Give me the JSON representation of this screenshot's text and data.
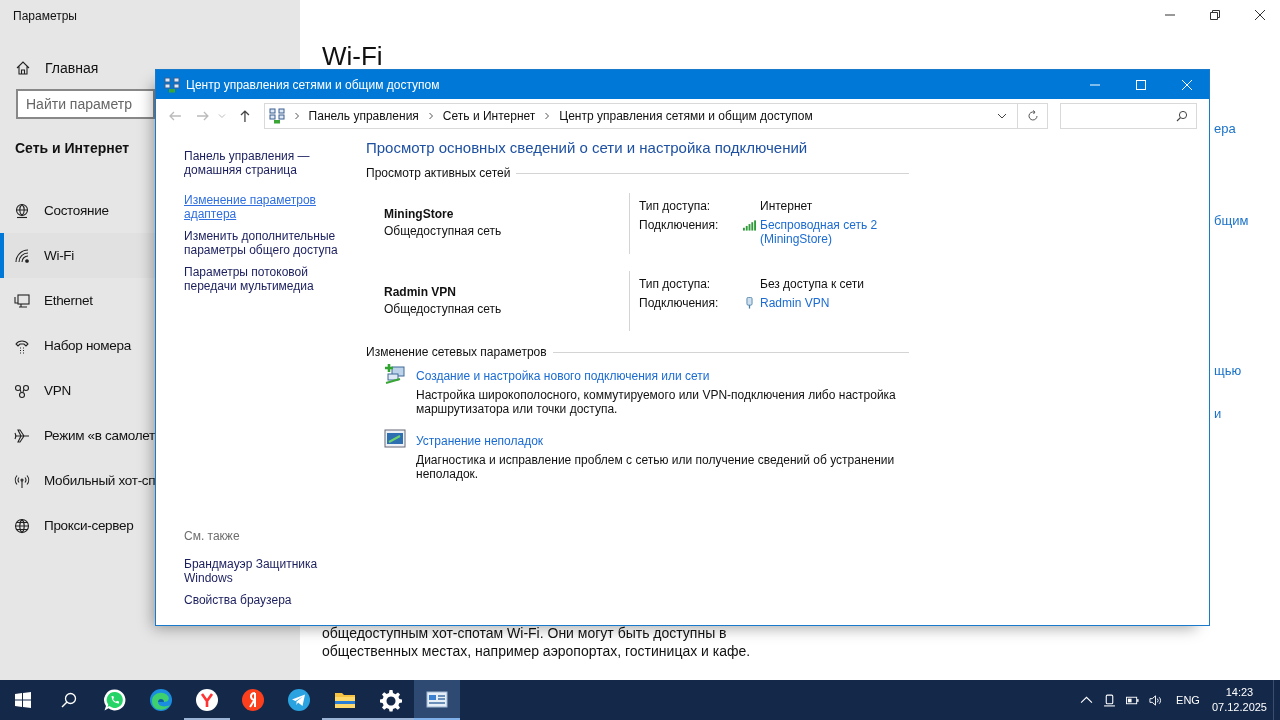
{
  "settings": {
    "title": "Параметры",
    "home": "Главная",
    "search": {
      "placeholder": "Найти параметр"
    },
    "section": "Сеть и Интернет",
    "nav": [
      {
        "label": "Состояние",
        "kind": "status",
        "selected": false
      },
      {
        "label": "Wi-Fi",
        "kind": "wifi",
        "selected": true
      },
      {
        "label": "Ethernet",
        "kind": "ethernet",
        "selected": false
      },
      {
        "label": "Набор номера",
        "kind": "dialup",
        "selected": false
      },
      {
        "label": "VPN",
        "kind": "vpn",
        "selected": false
      },
      {
        "label": "Режим «в самолет",
        "kind": "airplane",
        "selected": false
      },
      {
        "label": "Мобильный хот-сп",
        "kind": "hotspot",
        "selected": false
      },
      {
        "label": "Прокси-сервер",
        "kind": "proxy",
        "selected": false
      }
    ],
    "page_title": "Wi-Fi",
    "related_fragments": [
      "ера",
      "бщим",
      "щью",
      "и"
    ],
    "paragraph_lines": [
      "общедоступным хот-спотам Wi-Fi. Они могут быть доступны в",
      "общественных местах, например аэропортах, гостиницах и кафе."
    ]
  },
  "control_panel": {
    "title": "Центр управления сетями и общим доступом",
    "breadcrumbs": [
      "Панель управления",
      "Сеть и Интернет",
      "Центр управления сетями и общим доступом"
    ],
    "tasks": [
      {
        "label": "Панель управления — домашняя страница",
        "hovered": false
      },
      {
        "label": "Изменение параметров адаптера",
        "hovered": true
      },
      {
        "label": "Изменить дополнительные параметры общего доступа",
        "hovered": false
      },
      {
        "label": "Параметры потоковой передачи мультимедиа",
        "hovered": false
      }
    ],
    "see_also": {
      "title": "См. также",
      "links": [
        "Брандмауэр Защитника Windows",
        "Свойства браузера"
      ]
    },
    "heading": "Просмотр основных сведений о сети и настройка подключений",
    "active_networks": {
      "title": "Просмотр активных сетей",
      "networks": [
        {
          "name": "MiningStore",
          "category": "Общедоступная сеть",
          "access_label": "Тип доступа:",
          "access": "Интернет",
          "connections_label": "Подключения:",
          "connection": {
            "kind": "wifi",
            "label": "Беспроводная сеть 2 (MiningStore)"
          }
        },
        {
          "name": "Radmin VPN",
          "category": "Общедоступная сеть",
          "access_label": "Тип доступа:",
          "access": "Без доступа к сети",
          "connections_label": "Подключения:",
          "connection": {
            "kind": "adapter",
            "label": "Radmin VPN"
          }
        }
      ]
    },
    "change_settings": {
      "title": "Изменение сетевых параметров",
      "items": [
        {
          "kind": "new-connection",
          "link": "Создание и настройка нового подключения или сети",
          "description": "Настройка широкополосного, коммутируемого или VPN-подключения либо настройка маршрутизатора или точки доступа."
        },
        {
          "kind": "troubleshoot",
          "link": "Устранение неполадок",
          "description": "Диагностика и исправление проблем с сетью или получение сведений об устранении неполадок."
        }
      ]
    }
  },
  "taskbar": {
    "apps": [
      {
        "kind": "whatsapp",
        "running": false,
        "active": false
      },
      {
        "kind": "edge",
        "running": false,
        "active": false
      },
      {
        "kind": "yandex-browser",
        "running": true,
        "active": false
      },
      {
        "kind": "yandex",
        "running": false,
        "active": false
      },
      {
        "kind": "telegram",
        "running": false,
        "active": false
      },
      {
        "kind": "explorer",
        "running": true,
        "active": false
      },
      {
        "kind": "settings",
        "running": true,
        "active": false
      },
      {
        "kind": "control-panel",
        "running": true,
        "active": true
      }
    ],
    "language": "ENG",
    "time": "14:23",
    "date": "07.12.2025"
  }
}
